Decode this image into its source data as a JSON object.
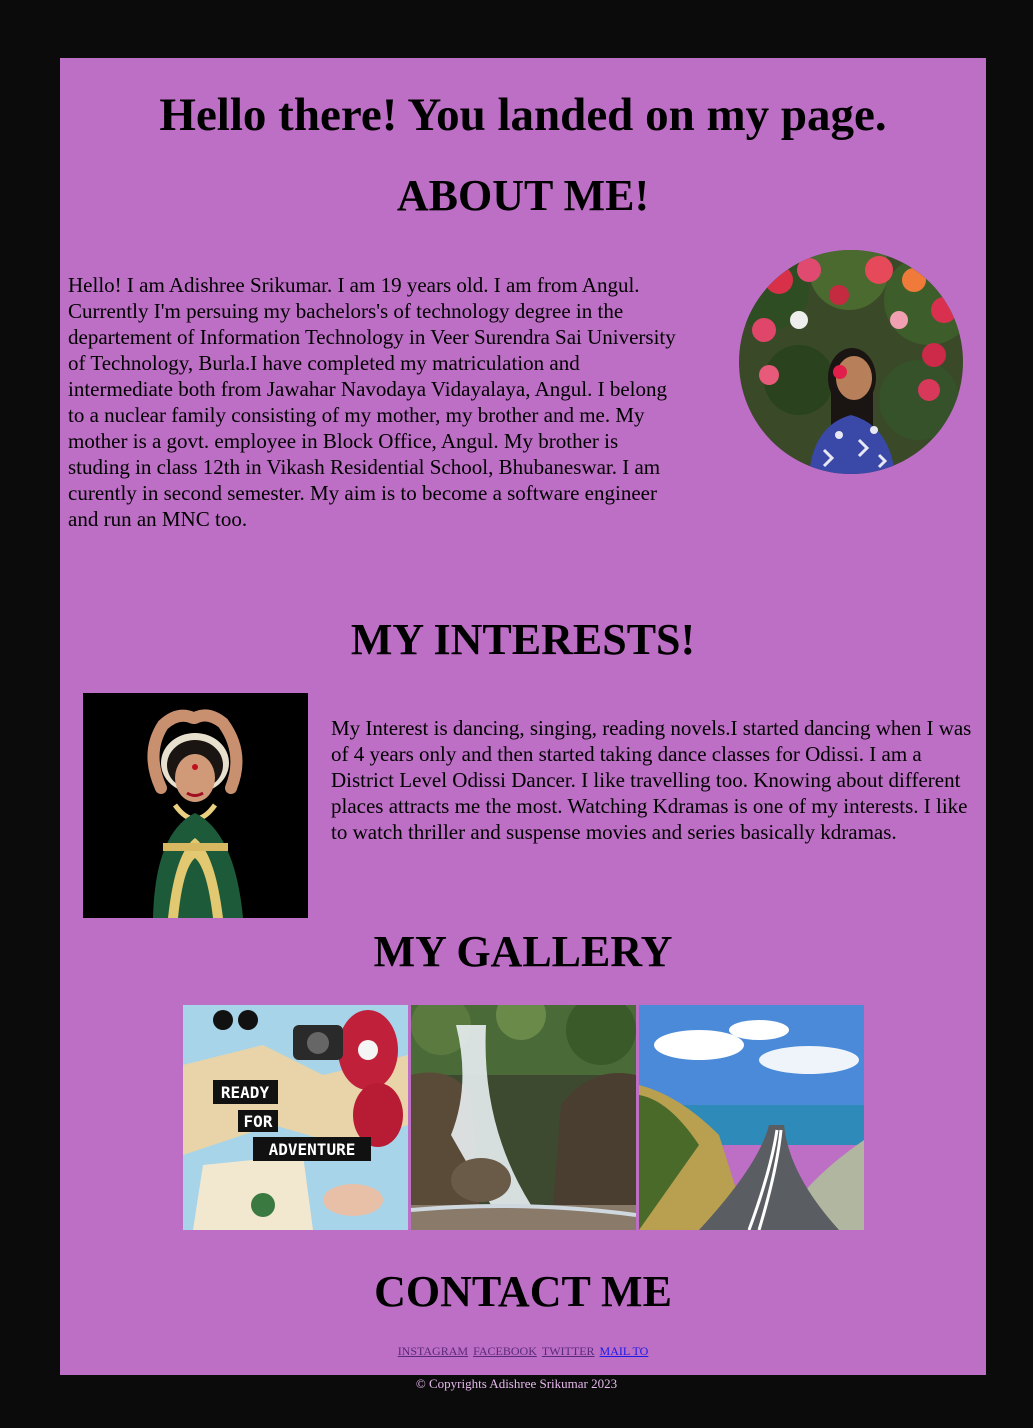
{
  "page": {
    "title": "Hello there! You landed on my page."
  },
  "about": {
    "heading": "ABOUT ME!",
    "text": "Hello! I am Adishree Srikumar. I am 19 years old. I am from Angul. Currently I'm persuing my bachelors's of technology degree in the departement of Information Technology in Veer Surendra Sai University of Technology, Burla.I have completed my matriculation and intermediate both from Jawahar Navodaya Vidayalaya, Angul. I belong to a nuclear family consisting of my mother, my brother and me. My mother is a govt. employee in Block Office, Angul. My brother is studing in class 12th in Vikash Residential School, Bhubaneswar. I am curently in second semester. My aim is to become a software engineer and run an MNC too."
  },
  "interests": {
    "heading": "MY INTERESTS!",
    "text": "My Interest is dancing, singing, reading novels.I started dancing when I was of 4 years only and then started taking dance classes for Odissi. I am a District Level Odissi Dancer. I like travelling too. Knowing about different places attracts me the most. Watching Kdramas is one of my interests. I like to watch thriller and suspense movies and series basically kdramas."
  },
  "gallery": {
    "heading": "MY GALLERY",
    "image1_caption": "READY FOR ADVENTURE"
  },
  "contact": {
    "heading": "CONTACT ME",
    "links": [
      "INSTAGRAM",
      "FACEBOOK",
      "TWITTER",
      "MAIL TO"
    ]
  },
  "footer": {
    "copyright": "© Copyrights Adishree Srikumar 2023"
  },
  "colors": {
    "page_background": "#0b0b0b",
    "panel_background": "#bd6ec5",
    "link_visited": "#5a2a7a",
    "link_mailto": "#1a1ae6",
    "copyright_text": "#e7b9ee"
  }
}
